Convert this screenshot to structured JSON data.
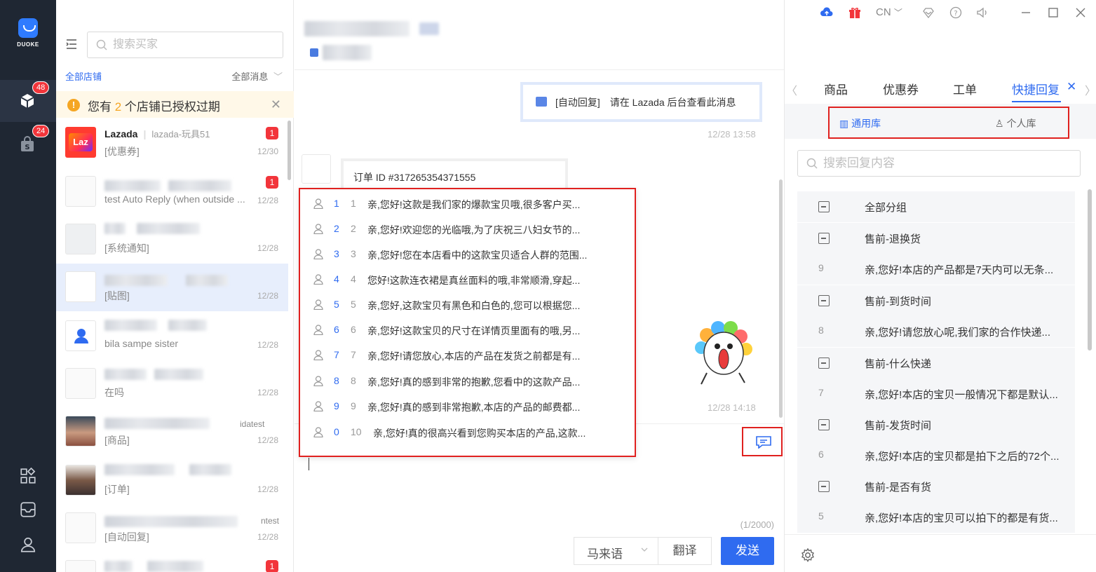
{
  "app": {
    "logo_text": "DUOKE",
    "colors": {
      "accent": "#2f6bf0",
      "rail": "#1f2733",
      "badge": "#f2353b",
      "highlight_border": "#e0211f"
    }
  },
  "rail": {
    "items": [
      {
        "icon": "chat-cube-icon",
        "badge": "48"
      },
      {
        "icon": "shopping-bag-icon",
        "badge": "24"
      }
    ],
    "bottom": [
      "apps-grid-icon",
      "inbox-icon",
      "user-icon"
    ]
  },
  "list": {
    "search_placeholder": "搜索买家",
    "filter_shops": "全部店铺",
    "filter_messages": "全部消息",
    "warning": {
      "prefix": "您有 ",
      "count": "2",
      "suffix": " 个店铺已授权过期"
    },
    "conversations": [
      {
        "name": "Lazada",
        "shop": "lazada-玩具51",
        "preview": "[优惠券]",
        "time": "12/30",
        "unread": "1"
      },
      {
        "name": "",
        "shop": "",
        "preview": "test Auto Reply (when outside ...",
        "time": "12/28",
        "unread": "1"
      },
      {
        "name": "",
        "shop": "",
        "preview": "[系统通知]",
        "time": "12/28",
        "unread": ""
      },
      {
        "name": "",
        "shop": "",
        "preview": "[贴图]",
        "time": "12/28",
        "unread": ""
      },
      {
        "name": "",
        "shop": "",
        "preview": "bila sampe sister",
        "time": "12/28",
        "unread": ""
      },
      {
        "name": "",
        "shop": "",
        "preview": "在吗",
        "time": "12/28",
        "unread": ""
      },
      {
        "name": "",
        "shop": "idatest",
        "preview": "[商品]",
        "time": "12/28",
        "unread": ""
      },
      {
        "name": "",
        "shop": "",
        "preview": "[订单]",
        "time": "12/28",
        "unread": ""
      },
      {
        "name": "",
        "shop": "ntest",
        "preview": "[自动回复]",
        "time": "12/28",
        "unread": ""
      },
      {
        "name": "",
        "shop": "",
        "preview": "",
        "time": "",
        "unread": "1"
      }
    ]
  },
  "chat": {
    "auto_reply": "[自动回复]　请在 Lazada 后台查看此消息",
    "auto_reply_time": "12/28 13:58",
    "order": "订单 ID #317265354371555",
    "sticker_time": "12/28 14:18",
    "quick_replies": [
      {
        "key": "1",
        "num": "1",
        "text": "亲,您好!这款是我们家的爆款宝贝哦,很多客户买..."
      },
      {
        "key": "2",
        "num": "2",
        "text": "亲,您好!欢迎您的光临哦,为了庆祝三八妇女节的..."
      },
      {
        "key": "3",
        "num": "3",
        "text": "亲,您好!您在本店看中的这款宝贝适合人群的范围..."
      },
      {
        "key": "4",
        "num": "4",
        "text": "您好!这款连衣裙是真丝面料的哦,非常顺滑,穿起..."
      },
      {
        "key": "5",
        "num": "5",
        "text": "亲,您好,这款宝贝有黑色和白色的,您可以根据您..."
      },
      {
        "key": "6",
        "num": "6",
        "text": "亲,您好!这款宝贝的尺寸在详情页里面有的哦,另..."
      },
      {
        "key": "7",
        "num": "7",
        "text": "亲,您好!请您放心,本店的产品在发货之前都是有..."
      },
      {
        "key": "8",
        "num": "8",
        "text": "亲,您好!真的感到非常的抱歉,您看中的这款产品..."
      },
      {
        "key": "9",
        "num": "9",
        "text": "亲,您好!真的感到非常抱歉,本店的产品的邮费都..."
      },
      {
        "key": "0",
        "num": "10",
        "text": "亲,您好!真的很高兴看到您购买本店的产品,这款..."
      }
    ],
    "char_counter": "(1/2000)",
    "language": "马来语",
    "translate_label": "翻译",
    "send_label": "发送"
  },
  "right": {
    "window": {
      "lang": "CN"
    },
    "tabs": [
      "商品",
      "优惠券",
      "工单",
      "快捷回复"
    ],
    "active_tab": "快捷回复",
    "library": {
      "common": "通用库",
      "personal": "个人库"
    },
    "search_placeholder": "搜索回复内容",
    "groups": [
      {
        "type": "group",
        "text": "全部分组"
      },
      {
        "type": "group",
        "text": "售前-退换货"
      },
      {
        "type": "item",
        "num": "9",
        "text": "亲,您好!本店的产品都是7天内可以无条..."
      },
      {
        "type": "group",
        "text": "售前-到货时间"
      },
      {
        "type": "item",
        "num": "8",
        "text": "亲,您好!请您放心呢,我们家的合作快递..."
      },
      {
        "type": "group",
        "text": "售前-什么快递"
      },
      {
        "type": "item",
        "num": "7",
        "text": "亲,您好!本店的宝贝一般情况下都是默认..."
      },
      {
        "type": "group",
        "text": "售前-发货时间"
      },
      {
        "type": "item",
        "num": "6",
        "text": "亲,您好!本店的宝贝都是拍下之后的72个..."
      },
      {
        "type": "group",
        "text": "售前-是否有货"
      },
      {
        "type": "item",
        "num": "5",
        "text": "亲,您好!本店的宝贝可以拍下的都是有货..."
      }
    ]
  }
}
